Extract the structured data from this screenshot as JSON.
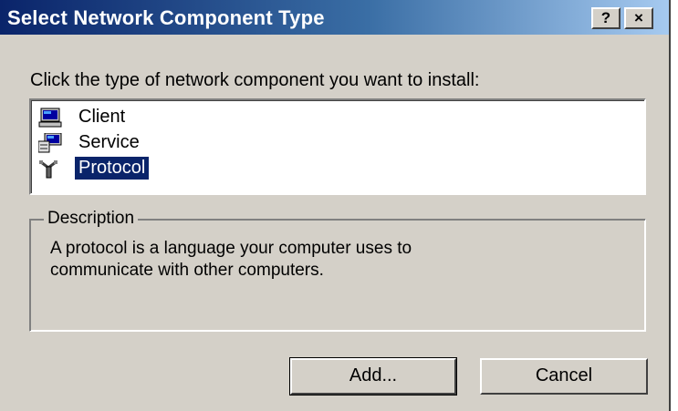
{
  "window": {
    "title": "Select Network Component Type",
    "help_button": "?",
    "close_button": "×"
  },
  "prompt": "Click the type of network component you want to install:",
  "components": [
    {
      "label": "Client",
      "icon": "client-computer-icon",
      "selected": false
    },
    {
      "label": "Service",
      "icon": "service-computer-icon",
      "selected": false
    },
    {
      "label": "Protocol",
      "icon": "protocol-plug-icon",
      "selected": true
    }
  ],
  "description": {
    "legend": "Description",
    "line1": "A protocol is a language your computer uses to",
    "line2": "communicate with other computers."
  },
  "buttons": {
    "add": "Add...",
    "cancel": "Cancel"
  },
  "colors": {
    "titlebar_start": "#0a246a",
    "titlebar_end": "#a6caf0",
    "selection": "#0a246a",
    "dialog_face": "#d4d0c8"
  }
}
